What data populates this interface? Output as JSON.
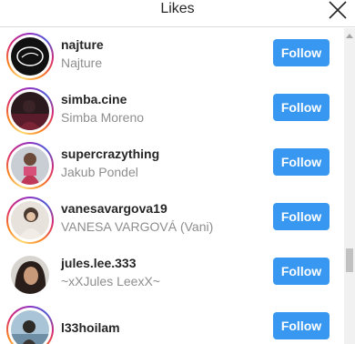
{
  "header": {
    "title": "Likes"
  },
  "colors": {
    "follow_button": "#3897f0",
    "story_ring": "#d62976"
  },
  "rows": [
    {
      "username": "najture",
      "fullname": "Najture",
      "button": "Follow"
    },
    {
      "username": "simba.cine",
      "fullname": "Simba Moreno",
      "button": "Follow"
    },
    {
      "username": "supercrazything",
      "fullname": "Jakub Pondel",
      "button": "Follow"
    },
    {
      "username": "vanesavargova19",
      "fullname": "VANESA VARGOVÁ (Vani)",
      "button": "Follow"
    },
    {
      "username": "jules.lee.333",
      "fullname": "~xXJules LeexX~",
      "button": "Follow"
    },
    {
      "username": "l33hoilam",
      "fullname": "",
      "button": "Follow"
    }
  ]
}
